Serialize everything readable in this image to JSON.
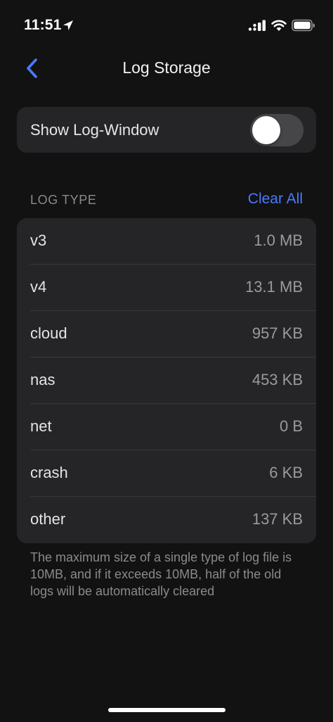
{
  "status_bar": {
    "time": "11:51",
    "icons": [
      "location-arrow-icon",
      "cellular-signal-icon",
      "wifi-icon",
      "battery-icon"
    ]
  },
  "nav": {
    "title": "Log Storage",
    "back_icon": "chevron-left-icon"
  },
  "settings": {
    "show_log_window_label": "Show Log-Window",
    "show_log_window_enabled": false
  },
  "log_section": {
    "header": "LOG TYPE",
    "clear_all_label": "Clear All",
    "rows": [
      {
        "name": "v3",
        "size": "1.0 MB"
      },
      {
        "name": "v4",
        "size": "13.1 MB"
      },
      {
        "name": "cloud",
        "size": "957 KB"
      },
      {
        "name": "nas",
        "size": "453 KB"
      },
      {
        "name": "net",
        "size": "0 B"
      },
      {
        "name": "crash",
        "size": "6 KB"
      },
      {
        "name": "other",
        "size": "137 KB"
      }
    ],
    "footer": "The maximum size of a single type of log file is 10MB, and if it exceeds 10MB, half of the old logs will be automatically cleared"
  },
  "colors": {
    "background": "#121212",
    "card": "#252527",
    "accent": "#4a7bff",
    "secondary_text": "#8a8a8f"
  }
}
